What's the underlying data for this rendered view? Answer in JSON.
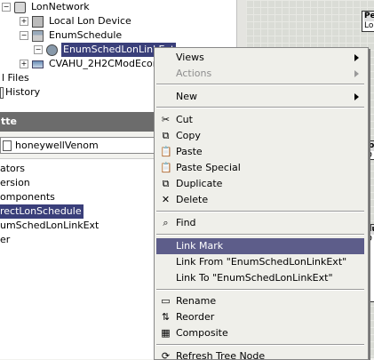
{
  "tree": {
    "nodes": [
      {
        "label": "LonNetwork",
        "toggle": "−",
        "icon": "network-icon"
      },
      {
        "label": "Local Lon Device",
        "toggle": "+",
        "icon": "device-icon"
      },
      {
        "label": "EnumSchedule",
        "toggle": "−",
        "icon": "schedule-icon"
      },
      {
        "label": "EnumSchedLonLinkExt",
        "toggle": "−",
        "icon": "link-ext-icon"
      },
      {
        "label": "CVAHU_2H2CModEcon",
        "toggle": "+",
        "icon": "lon-device-icon"
      },
      {
        "label": "l Files"
      },
      {
        "label": "History"
      }
    ]
  },
  "palette": {
    "header": "tte",
    "field_value": "honeywellVenom",
    "items": [
      "ators",
      "ersion",
      "omponents",
      "rectLonSchedule",
      "umSchedLonLinkExt",
      "er"
    ]
  },
  "canvas": {
    "box1": {
      "title": "Pe",
      "sub": "Lon"
    },
    "box2": {
      "title": "lo",
      "sub": "D"
    },
    "box3": {
      "title": "du",
      "sub": "D"
    }
  },
  "menu": {
    "items": [
      {
        "label": "Views",
        "submenu": true
      },
      {
        "label": "Actions",
        "submenu": true,
        "disabled": true
      },
      {
        "label": "New",
        "submenu": true
      },
      {
        "label": "Cut",
        "icon": "✂"
      },
      {
        "label": "Copy",
        "icon": "⧉"
      },
      {
        "label": "Paste",
        "icon": "📋"
      },
      {
        "label": "Paste Special",
        "icon": "📋"
      },
      {
        "label": "Duplicate",
        "icon": "⧉"
      },
      {
        "label": "Delete",
        "icon": "✕"
      },
      {
        "label": "Find",
        "icon": "⌕"
      },
      {
        "label": "Link Mark",
        "highlighted": true
      },
      {
        "label": "Link From \"EnumSchedLonLinkExt\""
      },
      {
        "label": "Link To \"EnumSchedLonLinkExt\""
      },
      {
        "label": "Rename",
        "icon": "▭"
      },
      {
        "label": "Reorder",
        "icon": "⇅"
      },
      {
        "label": "Composite",
        "icon": "▦"
      },
      {
        "label": "Refresh Tree Node",
        "icon": "⟳"
      }
    ]
  },
  "colors": {
    "selection": "#3a3f7a",
    "menu_highlight": "#5d5d8a",
    "palette_header": "#6c6c6c"
  }
}
